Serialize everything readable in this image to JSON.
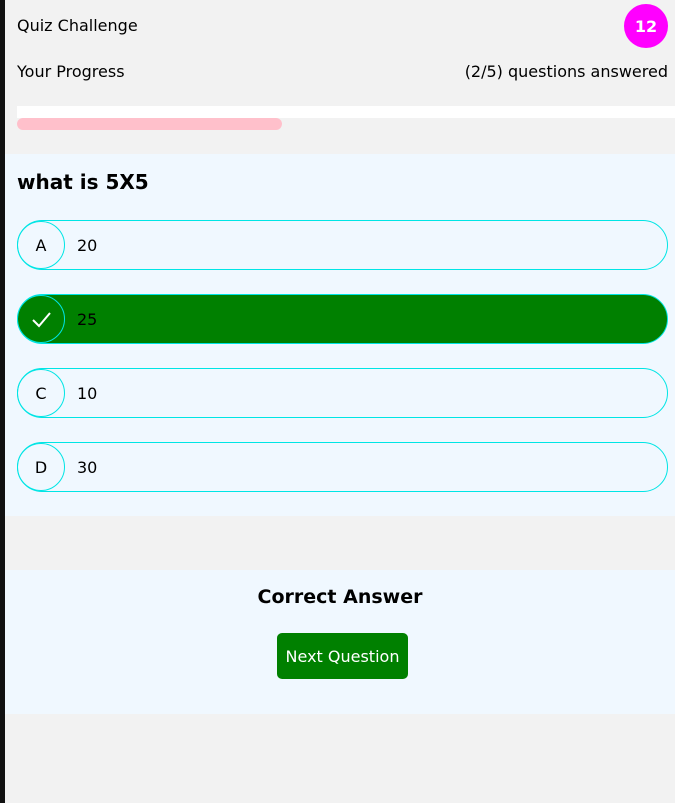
{
  "header": {
    "title": "Quiz Challenge",
    "score": "12"
  },
  "progress": {
    "label": "Your Progress",
    "status": "(2/5) questions answered",
    "fraction": 0.4
  },
  "question": {
    "text": "what is 5X5",
    "options": [
      {
        "letter": "A",
        "text": "20",
        "selected": false
      },
      {
        "letter": "",
        "text": "25",
        "selected": true,
        "icon": "checkmark-icon"
      },
      {
        "letter": "C",
        "text": "10",
        "selected": false
      },
      {
        "letter": "D",
        "text": "30",
        "selected": false
      }
    ]
  },
  "feedback": {
    "title": "Correct Answer",
    "next_label": "Next Question"
  },
  "colors": {
    "badge": "#ff00ff",
    "correct": "#008000",
    "progress_fill": "#ffc0cb",
    "option_border": "#00e5e5",
    "card_bg": "#f0f8ff"
  }
}
